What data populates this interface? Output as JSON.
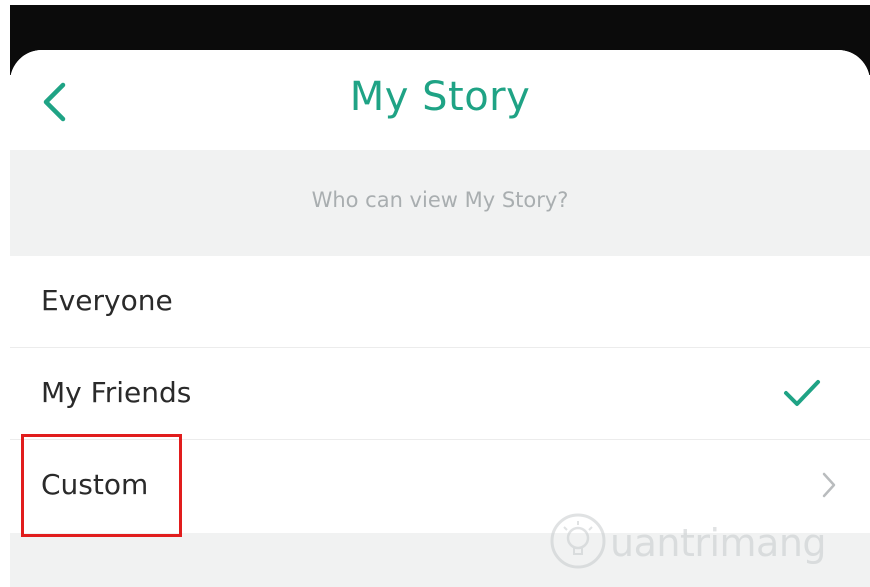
{
  "header": {
    "back_icon": "chevron-left-icon",
    "title": "My Story"
  },
  "section": {
    "prompt": "Who can view My Story?"
  },
  "options": [
    {
      "label": "Everyone",
      "selected": false,
      "trailing_icon": ""
    },
    {
      "label": "My Friends",
      "selected": true,
      "trailing_icon": "checkmark-icon"
    },
    {
      "label": "Custom",
      "selected": false,
      "trailing_icon": "chevron-right-icon"
    }
  ],
  "highlight": {
    "target": "Custom",
    "color": "#e11d1d"
  },
  "watermark": {
    "text": "uantrimang",
    "icon": "bulb-logo-icon"
  },
  "colors": {
    "accent": "#1fa385",
    "section_bg": "#f1f2f2",
    "top_bar": "#0b0b0b",
    "text_primary": "#2a2a2a",
    "text_muted": "#a9aeb0"
  }
}
